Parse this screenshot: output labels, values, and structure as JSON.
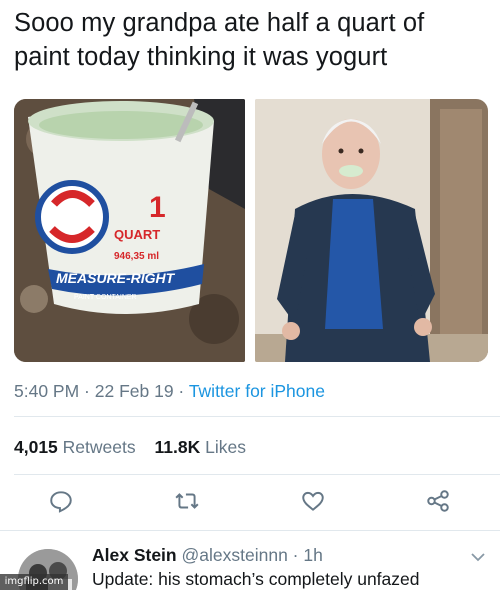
{
  "tweet": {
    "text_line1": "Sooo my grandpa ate half a quart of",
    "text_line2": "paint today thinking it was yogurt"
  },
  "media": {
    "can_label_number": "1",
    "can_label_unit": "QUART",
    "can_label_ml": "946,35 ml",
    "can_brand": "MEASURE-RIGHT",
    "can_brand_sub": "PAINT CONTAINER"
  },
  "meta": {
    "time": "5:40 PM",
    "sep1": " · ",
    "date": "22 Feb 19",
    "sep2": " · ",
    "source": "Twitter for iPhone"
  },
  "stats": {
    "retweets_count": "4,015",
    "retweets_label": "Retweets",
    "likes_count": "11.8K",
    "likes_label": "Likes"
  },
  "actions": {
    "icons": [
      "reply-icon",
      "retweet-icon",
      "like-icon",
      "share-icon"
    ]
  },
  "reply": {
    "name": "Alex Stein",
    "handle": "@alexsteinnn",
    "sep": " · ",
    "time": "1h",
    "text": "Update: his stomach’s completely unfazed"
  },
  "watermark": "imgflip.com",
  "colors": {
    "text": "#14171a",
    "muted": "#657786",
    "link": "#1b95e0",
    "divider": "#e1e8ed"
  }
}
